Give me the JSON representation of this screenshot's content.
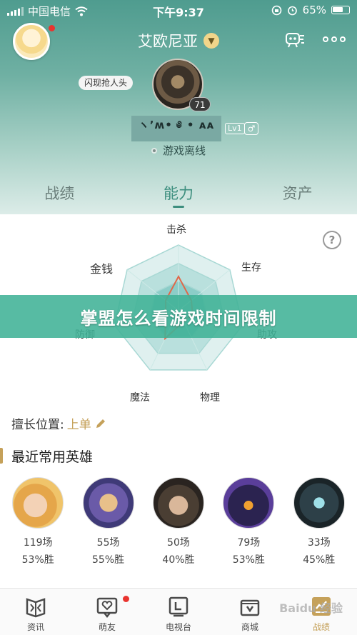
{
  "status_bar": {
    "carrier": "中国电信",
    "time": "下午9:37",
    "battery": "65%"
  },
  "header": {
    "server_name": "艾欧尼亚",
    "tag": "闪现抢人头",
    "level": "71",
    "player_name": "ヽ’ʍ• ༅ • ᴀᴀ",
    "lv_tag": "Lv1",
    "gender": "♂",
    "status": "游戏离线"
  },
  "tabs": [
    "战绩",
    "能力",
    "资产"
  ],
  "radar": {
    "labels": {
      "kill": "击杀",
      "survive": "生存",
      "assist": "助攻",
      "physical": "物理",
      "magic": "魔法",
      "defense": "防御",
      "money": "金钱"
    },
    "values": {
      "kill": 0.52,
      "survive": 0.25,
      "assist": 0.22,
      "physical": 0.18,
      "magic": 0.47,
      "defense": 0.2,
      "money": 0.25
    }
  },
  "banner": "掌盟怎么看游戏时间限制",
  "position": {
    "label": "擅长位置:",
    "value": "上单"
  },
  "section": {
    "title": "最近常用英雄"
  },
  "heroes": [
    {
      "games": "119场",
      "rate": "53%胜"
    },
    {
      "games": "55场",
      "rate": "55%胜"
    },
    {
      "games": "50场",
      "rate": "40%胜"
    },
    {
      "games": "79场",
      "rate": "53%胜"
    },
    {
      "games": "33场",
      "rate": "45%胜"
    }
  ],
  "nav": [
    "资讯",
    "萌友",
    "电视台",
    "商城",
    "战绩"
  ],
  "watermark": "Bai​du 经验",
  "colors": {
    "accent_teal": "#3e8f7f",
    "accent_gold": "#c5a15a",
    "radar_line": "#e0684a"
  }
}
